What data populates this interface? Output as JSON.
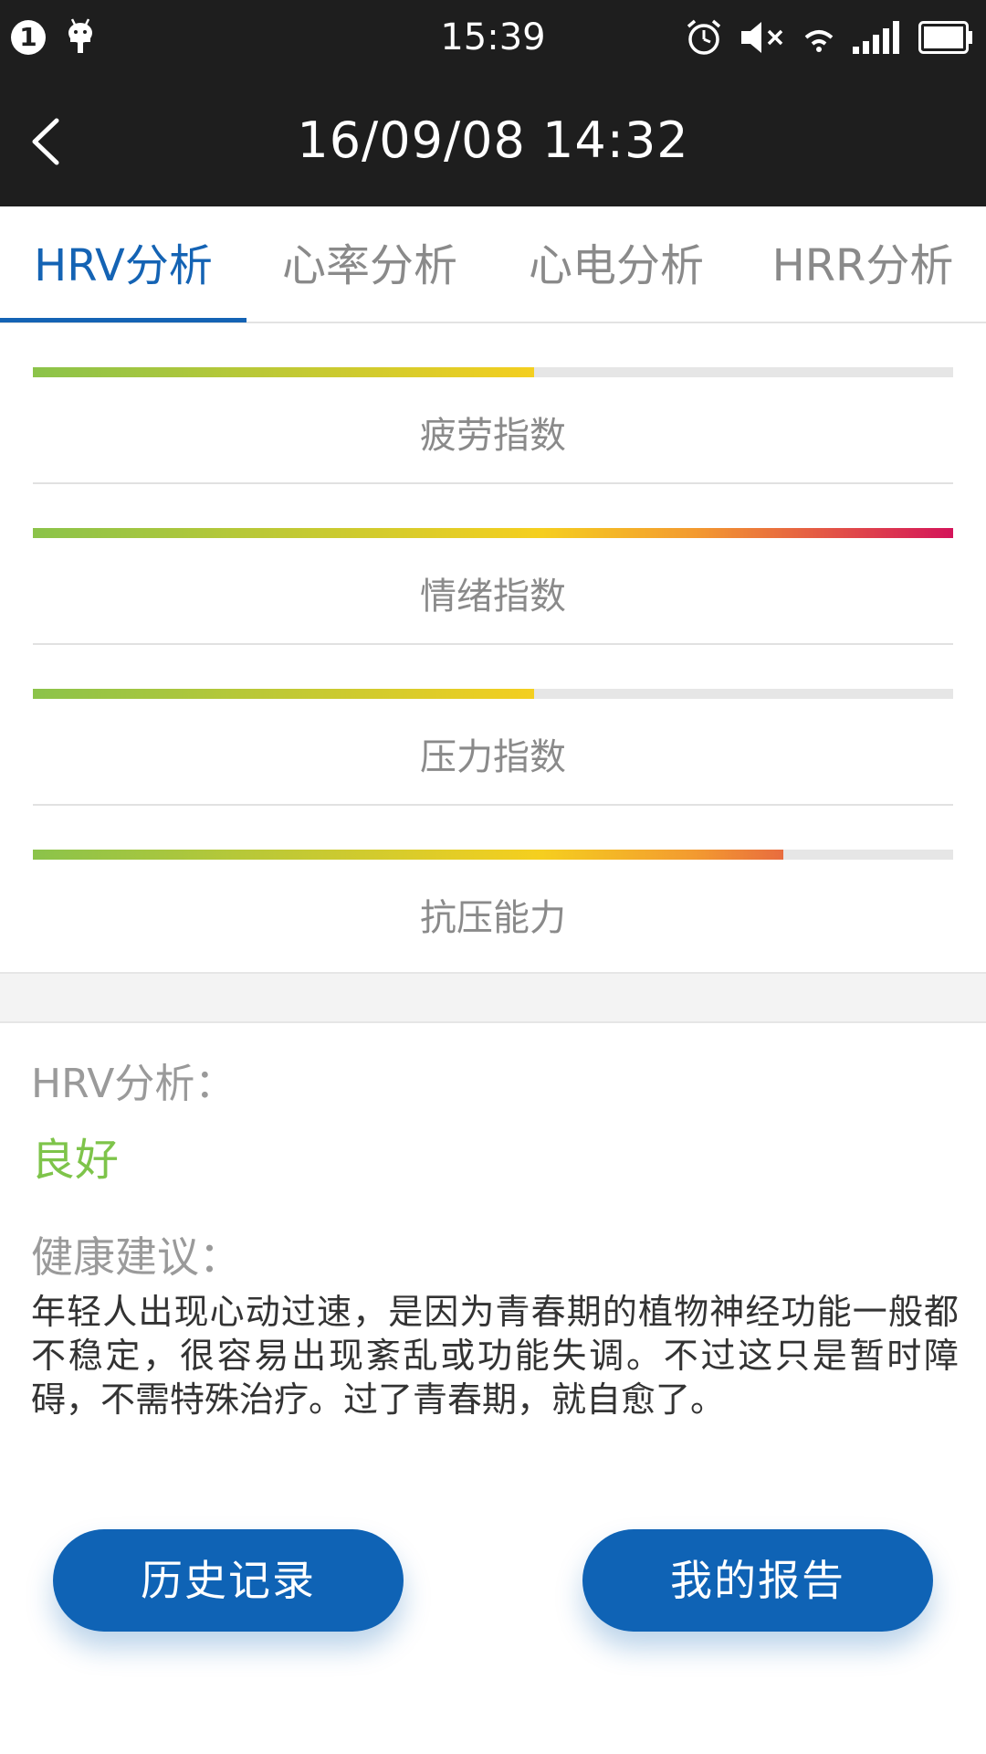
{
  "status_bar": {
    "notification_count": "1",
    "time": "15:39"
  },
  "header": {
    "title": "16/09/08 14:32"
  },
  "tabs": [
    {
      "label": "HRV分析",
      "active": true
    },
    {
      "label": "心率分析",
      "active": false
    },
    {
      "label": "心电分析",
      "active": false
    },
    {
      "label": "HRR分析",
      "active": false
    }
  ],
  "indices": [
    {
      "label": "疲劳指数",
      "level": 0.545
    },
    {
      "label": "情绪指数",
      "level": 1.0
    },
    {
      "label": "压力指数",
      "level": 0.545
    },
    {
      "label": "抗压能力",
      "level": 0.815
    }
  ],
  "colors": {
    "accent": "#1463b4",
    "good": "#7ec44a",
    "gradient_start": "#8bc34a",
    "gradient_mid": "#f5cf1f",
    "gradient_orange": "#f39a30",
    "gradient_end": "#d4145a"
  },
  "analysis": {
    "hrv_label": "HRV分析：",
    "hrv_result": "良好",
    "advice_label": "健康建议：",
    "advice_text": "年轻人出现心动过速，是因为青春期的植物神经功能一般都不稳定，很容易出现紊乱或功能失调。不过这只是暂时障碍，不需特殊治疗。过了青春期，就自愈了。"
  },
  "buttons": {
    "history": "历史记录",
    "report": "我的报告"
  }
}
